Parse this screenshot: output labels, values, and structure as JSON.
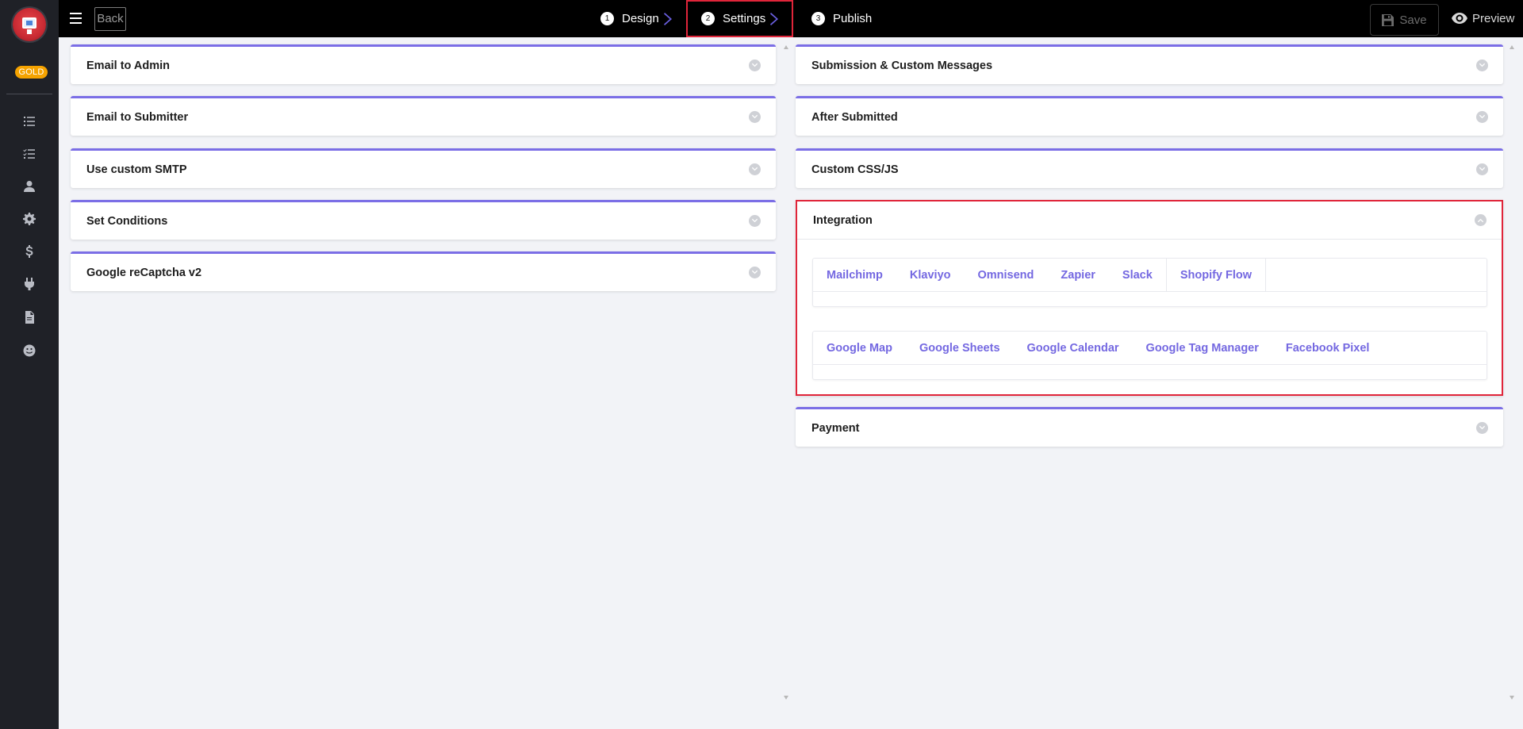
{
  "sidebar": {
    "badge": "GOLD",
    "icons": [
      "list-icon",
      "checklist-icon",
      "user-icon",
      "gear-icon",
      "dollar-icon",
      "plug-icon",
      "file-icon",
      "smile-icon"
    ]
  },
  "topbar": {
    "back_label": "Back",
    "steps": [
      {
        "num": "1",
        "label": "Design"
      },
      {
        "num": "2",
        "label": "Settings"
      },
      {
        "num": "3",
        "label": "Publish"
      }
    ],
    "save_label": "Save",
    "preview_label": "Preview"
  },
  "left_panels": [
    {
      "title": "Email to Admin"
    },
    {
      "title": "Email to Submitter"
    },
    {
      "title": "Use custom SMTP"
    },
    {
      "title": "Set Conditions"
    },
    {
      "title": "Google reCaptcha v2"
    }
  ],
  "right_panels": [
    {
      "title": "Submission & Custom Messages"
    },
    {
      "title": "After Submitted"
    },
    {
      "title": "Custom CSS/JS"
    }
  ],
  "integration": {
    "title": "Integration",
    "tabs_row1": [
      "Mailchimp",
      "Klaviyo",
      "Omnisend",
      "Zapier",
      "Slack",
      "Shopify Flow"
    ],
    "tabs_row2": [
      "Google Map",
      "Google Sheets",
      "Google Calendar",
      "Google Tag Manager",
      "Facebook Pixel"
    ]
  },
  "payment": {
    "title": "Payment"
  },
  "colors": {
    "accent": "#7b6ee6",
    "tab_text": "#7468e1",
    "highlight": "#e0253a",
    "gold": "#f5a300"
  }
}
